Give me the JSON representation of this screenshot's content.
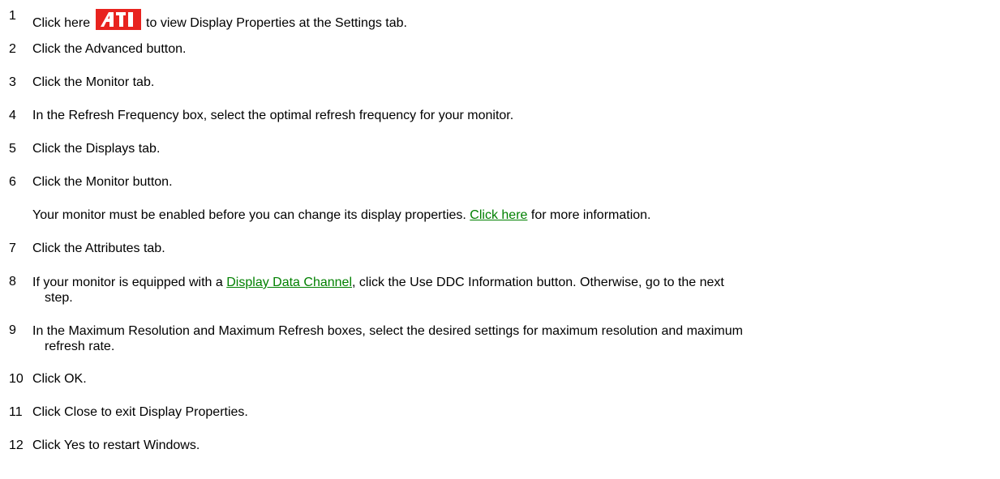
{
  "steps": [
    {
      "num": "1",
      "before": "Click here",
      "after": "to view Display Properties at the Settings tab.",
      "icon": "ati-logo-icon"
    },
    {
      "num": "2",
      "text": "Click the Advanced button."
    },
    {
      "num": "3",
      "text": "Click the Monitor tab."
    },
    {
      "num": "4",
      "text": "In the Refresh Frequency box, select the optimal refresh frequency for your monitor."
    },
    {
      "num": "5",
      "text": "Click the Displays tab."
    },
    {
      "num": "6",
      "text": "Click the Monitor button."
    },
    {
      "note_before": "Your monitor must be enabled before you can change its display properties.",
      "note_link": "Click here",
      "note_after": "for more information."
    },
    {
      "num": "7",
      "text": "Click the Attributes tab."
    },
    {
      "num": "8",
      "before": "If your monitor is equipped with a",
      "link": "Display Data Channel",
      "after": ", click the Use DDC Information button. Otherwise, go to the next",
      "rest": "step."
    },
    {
      "num": "9",
      "text": "In the Maximum Resolution and Maximum Refresh boxes, select the desired settings for maximum resolution and maximum",
      "rest": "refresh rate."
    },
    {
      "num": "10",
      "text": "Click OK."
    },
    {
      "num": "11",
      "text": "Click Close to exit Display Properties."
    },
    {
      "num": "12",
      "text": "Click Yes to restart Windows."
    }
  ],
  "colors": {
    "link": "#008000",
    "logo_red": "#e8231f"
  }
}
